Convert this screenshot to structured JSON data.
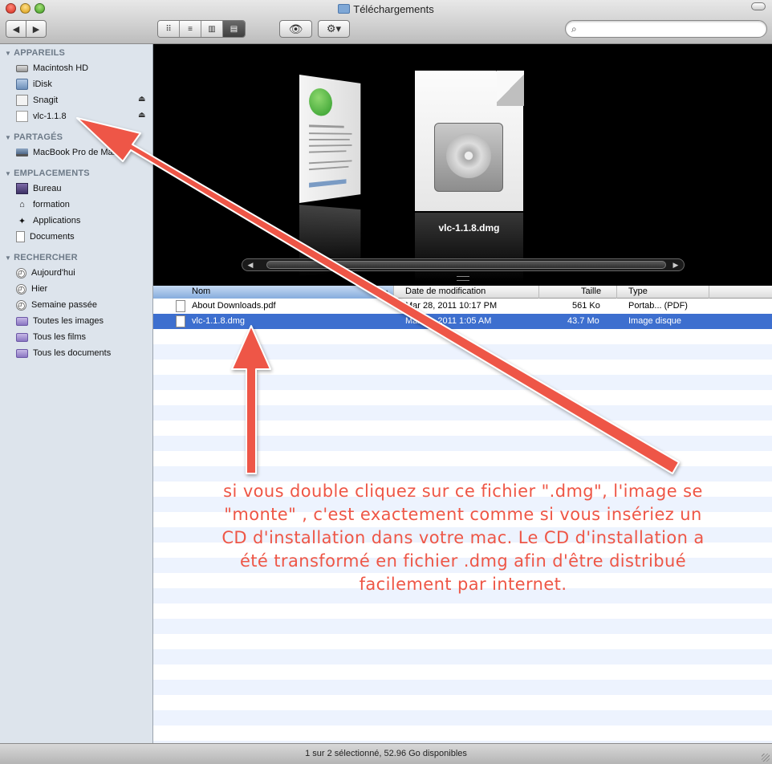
{
  "window": {
    "title": "Téléchargements"
  },
  "toolbar": {
    "back_label": "◀",
    "forward_label": "▶",
    "view_icons": [
      "⠿",
      "≡",
      "▥",
      "▤"
    ],
    "quicklook_label": "👁",
    "action_label": "⚙▾",
    "search": {
      "value": "",
      "placeholder": "",
      "icon": "⌕"
    }
  },
  "sidebar": {
    "sections": [
      {
        "label": "APPAREILS",
        "items": [
          "Macintosh HD",
          "iDisk",
          "Snagit",
          "vlc-1.1.8"
        ]
      },
      {
        "label": "PARTAGÉS",
        "items": [
          "MacBook Pro de Marc"
        ]
      },
      {
        "label": "EMPLACEMENTS",
        "items": [
          "Bureau",
          "formation",
          "Applications",
          "Documents"
        ]
      },
      {
        "label": "RECHERCHER",
        "items": [
          "Aujourd'hui",
          "Hier",
          "Semaine passée",
          "Toutes les images",
          "Tous les films",
          "Tous les documents"
        ]
      }
    ],
    "eject_symbol": "⏏"
  },
  "coverflow": {
    "caption": "vlc-1.1.8.dmg"
  },
  "columns": {
    "name": "Nom",
    "date": "Date de modification",
    "size": "Taille",
    "type": "Type",
    "sort_arrow": "▲"
  },
  "files": [
    {
      "name": "About Downloads.pdf",
      "date": "Mar 28, 2011 10:17 PM",
      "size": "561 Ko",
      "type": "Portab... (PDF)",
      "selected": false
    },
    {
      "name": "vlc-1.1.8.dmg",
      "date": "Mar 24, 2011 1:05 AM",
      "size": "43.7 Mo",
      "type": "Image disque",
      "selected": true
    }
  ],
  "annotation": {
    "text": "si vous double cliquez sur ce fichier \".dmg\", l'image se \"monte\" , c'est exactement comme si vous insériez un CD d'installation dans votre mac. Le CD d'installation a été transformé en fichier .dmg afin d'être distribué facilement par internet.",
    "color": "#ee5646"
  },
  "status": {
    "text": "1 sur 2 sélectionné, 52.96 Go disponibles"
  },
  "colors": {
    "selection": "#3d6fcf",
    "sidebar_bg": "#dde4ec",
    "stripe": "#edf3fe"
  }
}
